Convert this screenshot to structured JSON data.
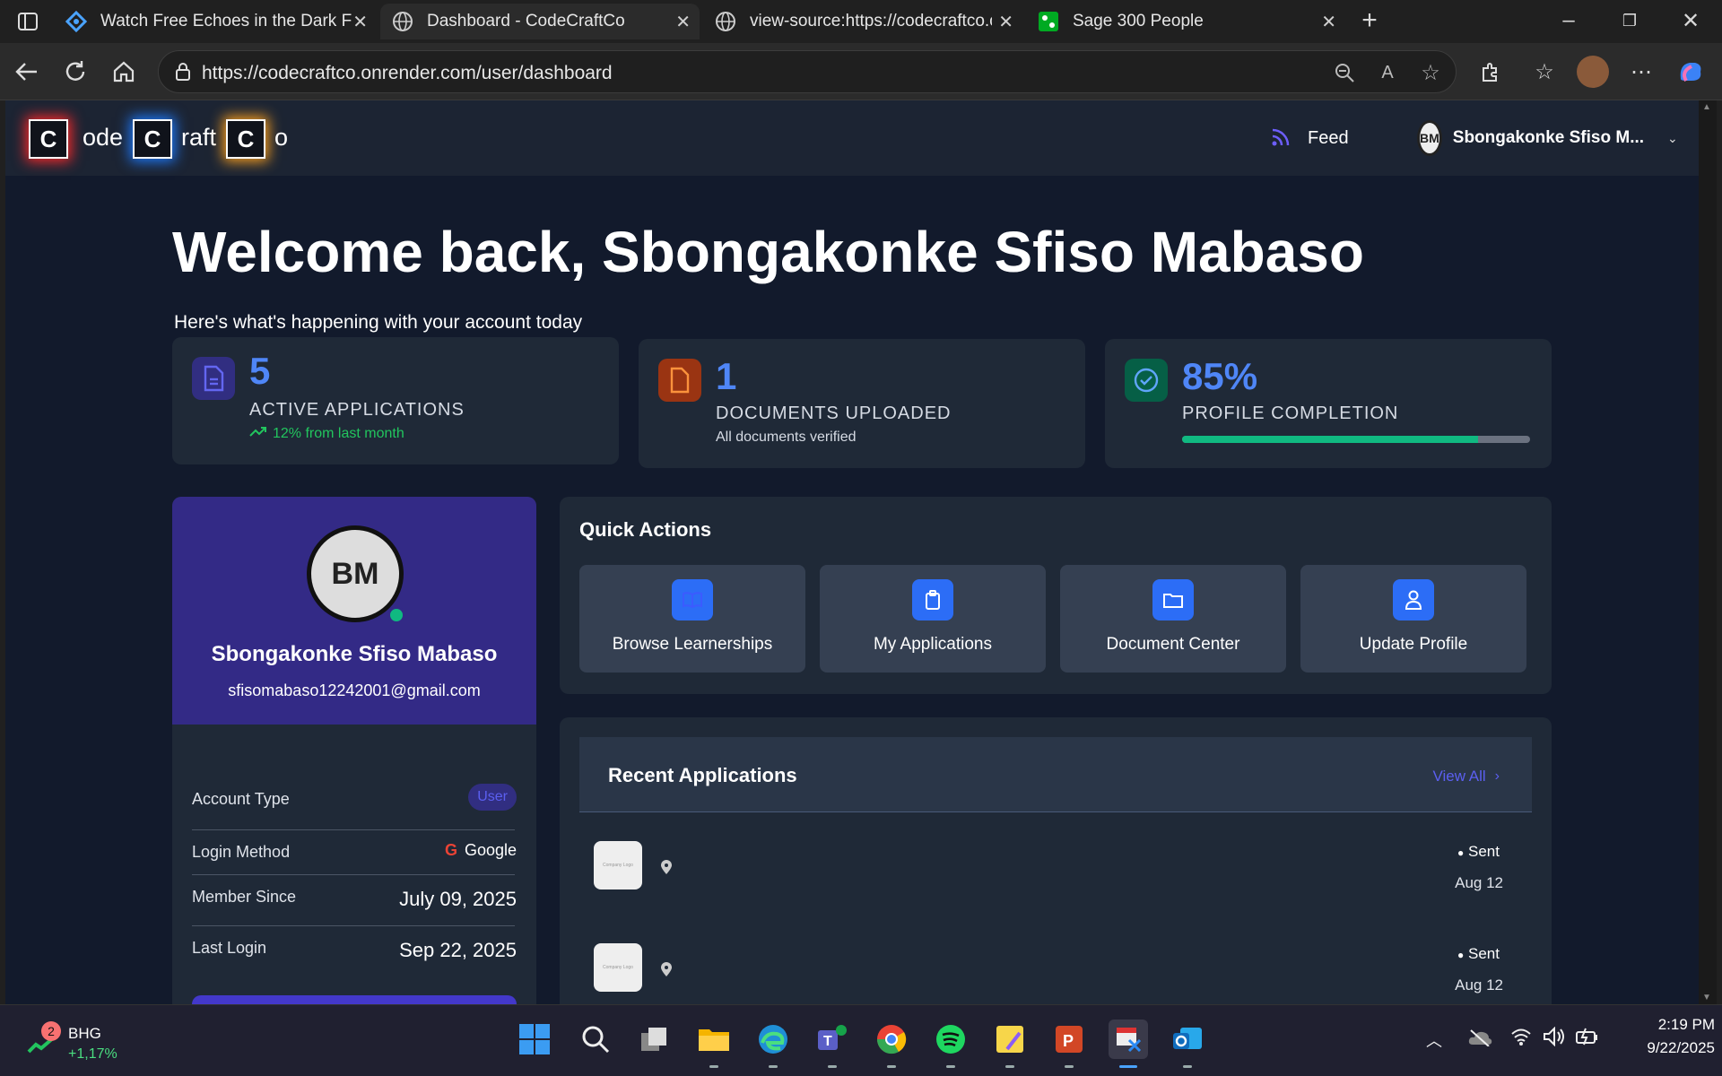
{
  "browser": {
    "tabs": [
      {
        "title": "Watch Free Echoes in the Dark Fu"
      },
      {
        "title": "Dashboard - CodeCraftCo"
      },
      {
        "title": "view-source:https://codecraftco.o"
      },
      {
        "title": "Sage 300 People"
      }
    ],
    "url": "https://codecraftco.onrender.com/user/dashboard"
  },
  "navbar": {
    "logo_letters": [
      "C",
      "C",
      "C"
    ],
    "logo_rest": [
      "ode",
      "raft",
      "o"
    ],
    "feed_label": "Feed",
    "user_name": "Sbongakonke Sfiso M...",
    "avatar_text": "BM"
  },
  "welcome": {
    "title": "Welcome back, Sbongakonke Sfiso Mabaso",
    "subtitle": "Here's what's happening with your account today"
  },
  "stats": [
    {
      "value": "5",
      "label": "ACTIVE APPLICATIONS",
      "sub": "12% from last month",
      "accent": "#22c55e"
    },
    {
      "value": "1",
      "label": "DOCUMENTS UPLOADED",
      "sub": "All documents verified",
      "accent": "#ea580c"
    },
    {
      "value": "85%",
      "label": "PROFILE COMPLETION",
      "progress": 0.85,
      "accent": "#10b981"
    }
  ],
  "profile": {
    "name": "Sbongakonke Sfiso Mabaso",
    "email": "sfisomabaso12242001@gmail.com",
    "avatar_text": "BM",
    "rows": [
      {
        "label": "Account Type",
        "value": "User"
      },
      {
        "label": "Login Method",
        "value": "Google"
      },
      {
        "label": "Member Since",
        "value": "July 09, 2025"
      },
      {
        "label": "Last Login",
        "value": "Sep 22, 2025"
      }
    ]
  },
  "quick_actions": {
    "title": "Quick Actions",
    "items": [
      {
        "label": "Browse Learnerships",
        "icon": "book-icon"
      },
      {
        "label": "My Applications",
        "icon": "clipboard-icon"
      },
      {
        "label": "Document Center",
        "icon": "folder-icon"
      },
      {
        "label": "Update Profile",
        "icon": "user-icon"
      }
    ]
  },
  "recent": {
    "title": "Recent Applications",
    "view_all": "View All",
    "items": [
      {
        "logo": "Company Logo",
        "status": "Sent",
        "date": "Aug 12"
      },
      {
        "logo": "Company Logo",
        "status": "Sent",
        "date": "Aug 12"
      }
    ]
  },
  "taskbar": {
    "stock_name": "BHG",
    "stock_change": "+1,17%",
    "badge": "2",
    "time": "2:19 PM",
    "date": "9/22/2025"
  }
}
